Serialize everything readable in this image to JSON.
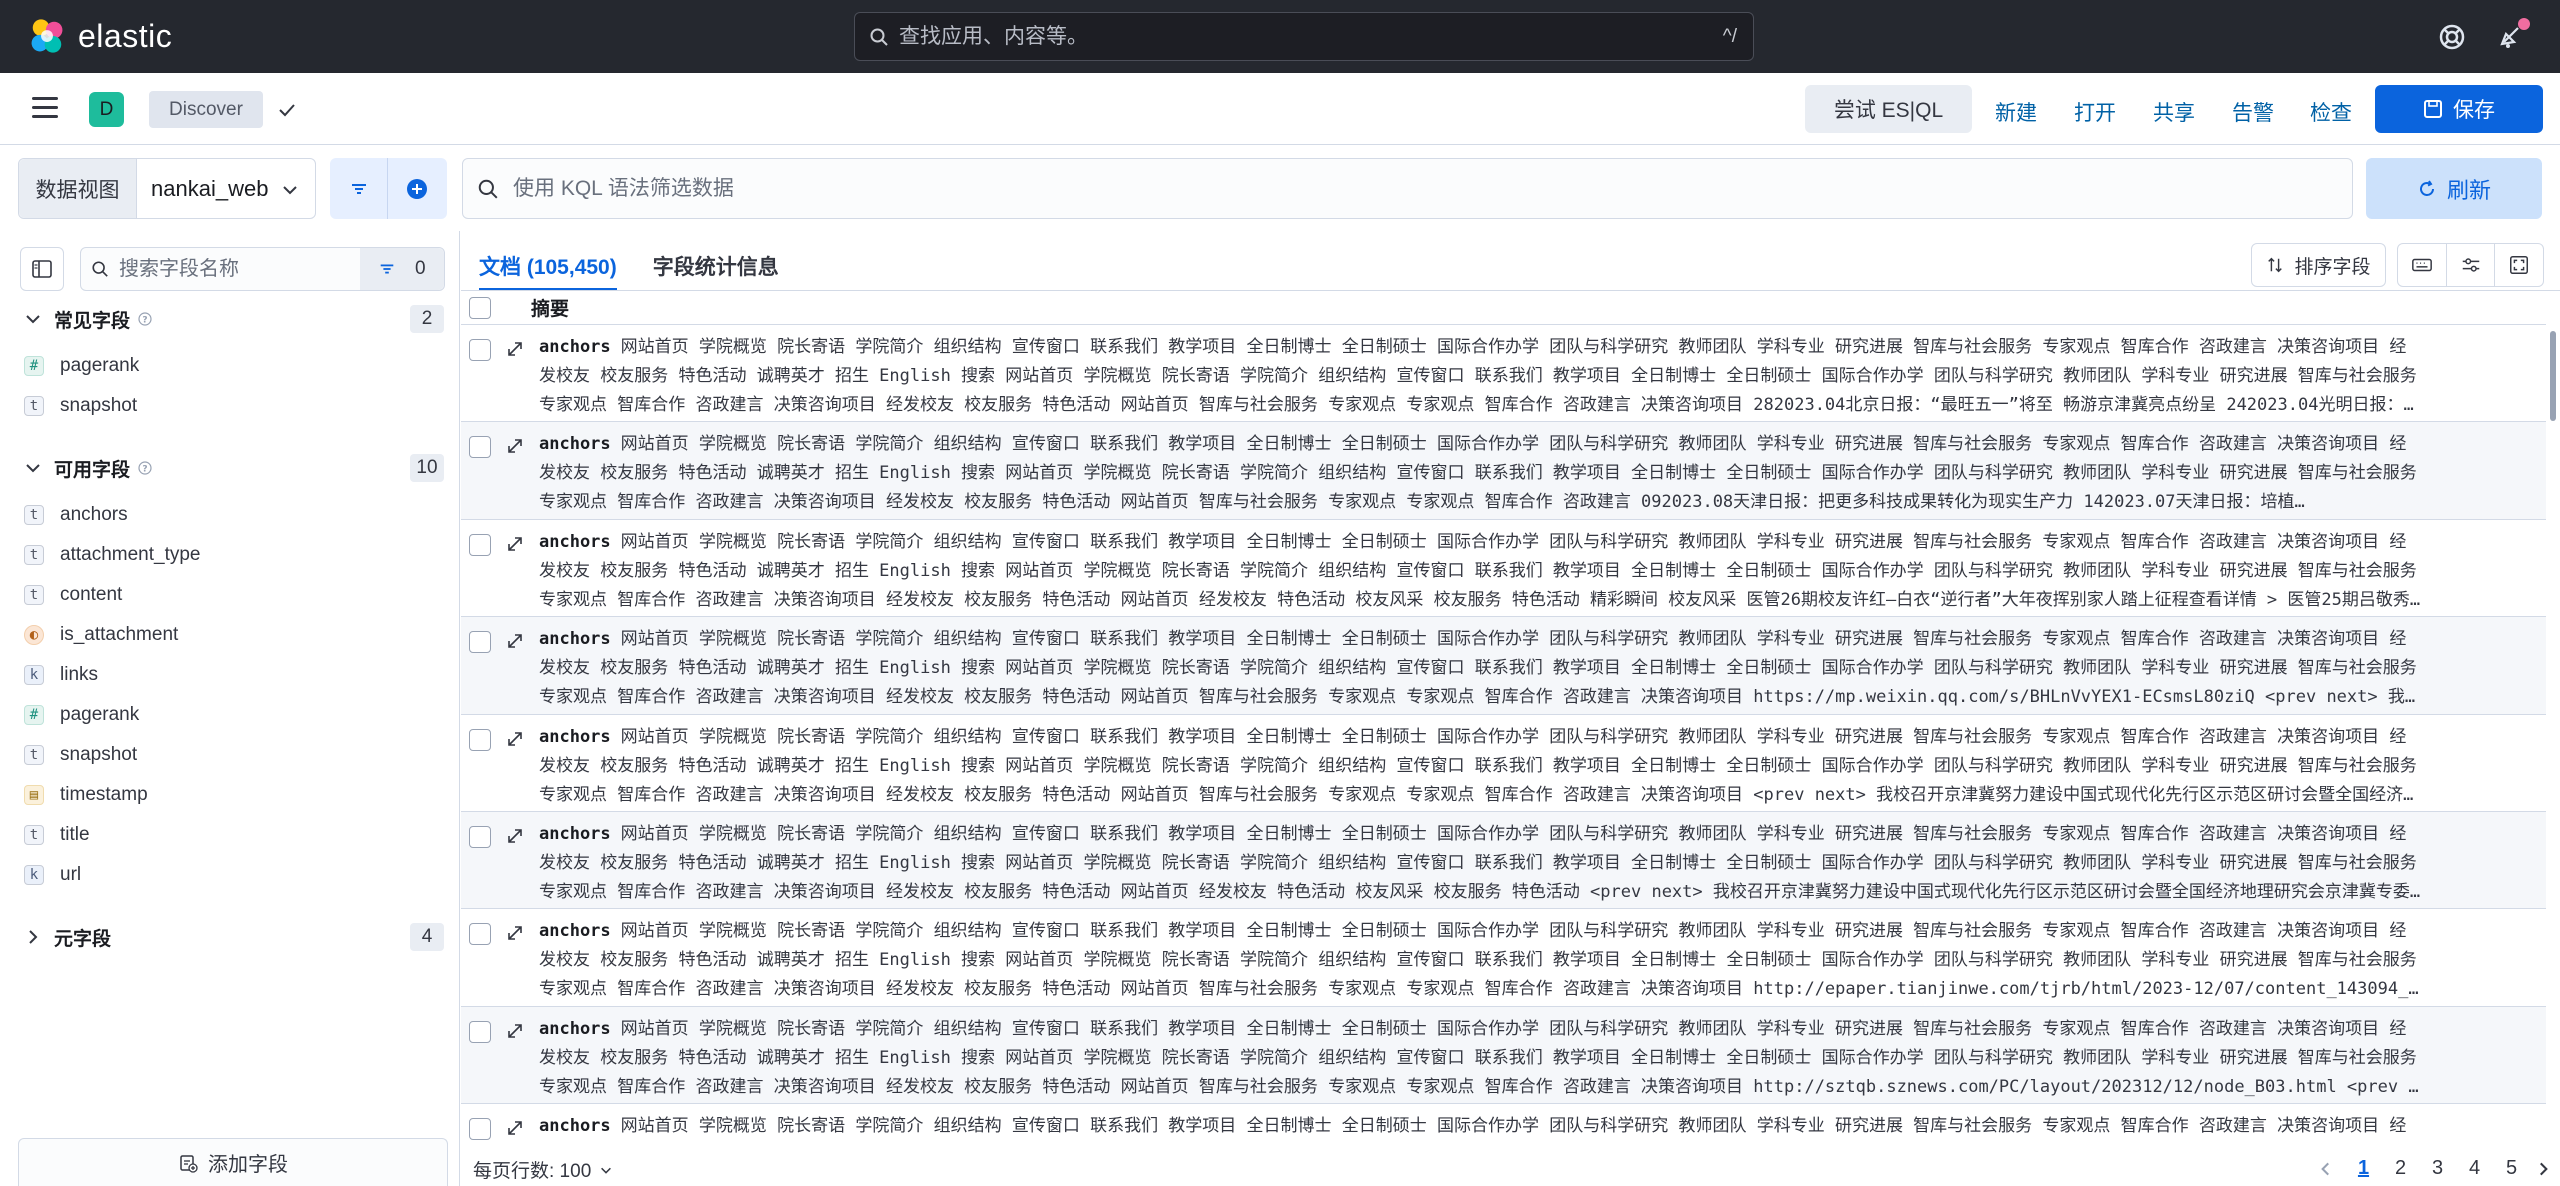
{
  "topbar": {
    "brand": "elastic",
    "search_placeholder": "查找应用、内容等。",
    "search_shortcut": "^/"
  },
  "appbar": {
    "space_letter": "D",
    "breadcrumb": "Discover",
    "esql_label": "尝试 ES|QL",
    "menu": {
      "new": "新建",
      "open": "打开",
      "share": "共享",
      "alerts": "告警",
      "inspect": "检查",
      "save": "保存"
    }
  },
  "querybar": {
    "dataview_label": "数据视图",
    "dataview_value": "nankai_web",
    "kql_placeholder": "使用 KQL 语法筛选数据",
    "refresh_label": "刷新"
  },
  "sidebar": {
    "search_placeholder": "搜索字段名称",
    "filter_count": "0",
    "sections": {
      "popular": {
        "title": "常见字段",
        "count": "2",
        "fields": [
          {
            "name": "pagerank",
            "type": "#"
          },
          {
            "name": "snapshot",
            "type": "t"
          }
        ]
      },
      "available": {
        "title": "可用字段",
        "count": "10",
        "fields": [
          {
            "name": "anchors",
            "type": "t"
          },
          {
            "name": "attachment_type",
            "type": "t"
          },
          {
            "name": "content",
            "type": "t"
          },
          {
            "name": "is_attachment",
            "type": "◐"
          },
          {
            "name": "links",
            "type": "k"
          },
          {
            "name": "pagerank",
            "type": "#"
          },
          {
            "name": "snapshot",
            "type": "t"
          },
          {
            "name": "timestamp",
            "type": "▤"
          },
          {
            "name": "title",
            "type": "t"
          },
          {
            "name": "url",
            "type": "k"
          }
        ]
      },
      "meta": {
        "title": "元字段",
        "count": "4"
      }
    },
    "add_field": "添加字段"
  },
  "main": {
    "tabs": {
      "documents": "文档 (105,450)",
      "field_stats": "字段统计信息"
    },
    "sort_fields": "排序字段",
    "column_header": "摘要",
    "rows": [
      {
        "key": "anchors",
        "line1": "网站首页 学院概览 院长寄语 学院简介 组织结构 宣传窗口 联系我们 教学项目 全日制博士 全日制硕士 国际合作办学 团队与科学研究 教师团队 学科专业 研究进展 智库与社会服务 专家观点 智库合作 咨政建言 决策咨询项目 经",
        "line2": "发校友 校友服务 特色活动 诚聘英才 招生 English 搜索 网站首页 学院概览 院长寄语 学院简介 组织结构 宣传窗口 联系我们 教学项目 全日制博士 全日制硕士 国际合作办学 团队与科学研究 教师团队 学科专业 研究进展 智库与社会服务",
        "line3": "专家观点 智库合作 咨政建言 决策咨询项目 经发校友 校友服务 特色活动 网站首页 智库与社会服务 专家观点 专家观点 智库合作 咨政建言 决策咨询项目 282023.04北京日报：“最旺五一”将至 畅游京津冀亮点纷呈 242023.04光明日报：…"
      },
      {
        "key": "anchors",
        "line1": "网站首页 学院概览 院长寄语 学院简介 组织结构 宣传窗口 联系我们 教学项目 全日制博士 全日制硕士 国际合作办学 团队与科学研究 教师团队 学科专业 研究进展 智库与社会服务 专家观点 智库合作 咨政建言 决策咨询项目 经",
        "line2": "发校友 校友服务 特色活动 诚聘英才 招生 English 搜索 网站首页 学院概览 院长寄语 学院简介 组织结构 宣传窗口 联系我们 教学项目 全日制博士 全日制硕士 国际合作办学 团队与科学研究 教师团队 学科专业 研究进展 智库与社会服务",
        "line3": "专家观点 智库合作 咨政建言 决策咨询项目 经发校友 校友服务 特色活动 网站首页 智库与社会服务 专家观点 专家观点 智库合作 咨政建言 092023.08天津日报：把更多科技成果转化为现实生产力 142023.07天津日报：培植…"
      },
      {
        "key": "anchors",
        "line1": "网站首页 学院概览 院长寄语 学院简介 组织结构 宣传窗口 联系我们 教学项目 全日制博士 全日制硕士 国际合作办学 团队与科学研究 教师团队 学科专业 研究进展 智库与社会服务 专家观点 智库合作 咨政建言 决策咨询项目 经",
        "line2": "发校友 校友服务 特色活动 诚聘英才 招生 English 搜索 网站首页 学院概览 院长寄语 学院简介 组织结构 宣传窗口 联系我们 教学项目 全日制博士 全日制硕士 国际合作办学 团队与科学研究 教师团队 学科专业 研究进展 智库与社会服务",
        "line3": "专家观点 智库合作 咨政建言 决策咨询项目 经发校友 校友服务 特色活动 网站首页 经发校友 特色活动 校友风采 校友服务 特色活动 精彩瞬间 校友风采 医管26期校友许红—白衣“逆行者”大年夜挥别家人踏上征程查看详情 > 医管25期吕敬秀…"
      },
      {
        "key": "anchors",
        "line1": "网站首页 学院概览 院长寄语 学院简介 组织结构 宣传窗口 联系我们 教学项目 全日制博士 全日制硕士 国际合作办学 团队与科学研究 教师团队 学科专业 研究进展 智库与社会服务 专家观点 智库合作 咨政建言 决策咨询项目 经",
        "line2": "发校友 校友服务 特色活动 诚聘英才 招生 English 搜索 网站首页 学院概览 院长寄语 学院简介 组织结构 宣传窗口 联系我们 教学项目 全日制博士 全日制硕士 国际合作办学 团队与科学研究 教师团队 学科专业 研究进展 智库与社会服务",
        "line3": "专家观点 智库合作 咨政建言 决策咨询项目 经发校友 校友服务 特色活动 网站首页 智库与社会服务 专家观点 专家观点 智库合作 咨政建言 决策咨询项目 https://mp.weixin.qq.com/s/BHLnVvYEX1-ECsmsL80ziQ <prev next> 我…"
      },
      {
        "key": "anchors",
        "line1": "网站首页 学院概览 院长寄语 学院简介 组织结构 宣传窗口 联系我们 教学项目 全日制博士 全日制硕士 国际合作办学 团队与科学研究 教师团队 学科专业 研究进展 智库与社会服务 专家观点 智库合作 咨政建言 决策咨询项目 经",
        "line2": "发校友 校友服务 特色活动 诚聘英才 招生 English 搜索 网站首页 学院概览 院长寄语 学院简介 组织结构 宣传窗口 联系我们 教学项目 全日制博士 全日制硕士 国际合作办学 团队与科学研究 教师团队 学科专业 研究进展 智库与社会服务",
        "line3": "专家观点 智库合作 咨政建言 决策咨询项目 经发校友 校友服务 特色活动 网站首页 智库与社会服务 专家观点 专家观点 智库合作 咨政建言 决策咨询项目 <prev next> 我校召开京津冀努力建设中国式现代化先行区示范区研讨会暨全国经济…"
      },
      {
        "key": "anchors",
        "line1": "网站首页 学院概览 院长寄语 学院简介 组织结构 宣传窗口 联系我们 教学项目 全日制博士 全日制硕士 国际合作办学 团队与科学研究 教师团队 学科专业 研究进展 智库与社会服务 专家观点 智库合作 咨政建言 决策咨询项目 经",
        "line2": "发校友 校友服务 特色活动 诚聘英才 招生 English 搜索 网站首页 学院概览 院长寄语 学院简介 组织结构 宣传窗口 联系我们 教学项目 全日制博士 全日制硕士 国际合作办学 团队与科学研究 教师团队 学科专业 研究进展 智库与社会服务",
        "line3": "专家观点 智库合作 咨政建言 决策咨询项目 经发校友 校友服务 特色活动 网站首页 经发校友 特色活动 校友风采 校友服务 特色活动 <prev next> 我校召开京津冀努力建设中国式现代化先行区示范区研讨会暨全国经济地理研究会京津冀专委…"
      },
      {
        "key": "anchors",
        "line1": "网站首页 学院概览 院长寄语 学院简介 组织结构 宣传窗口 联系我们 教学项目 全日制博士 全日制硕士 国际合作办学 团队与科学研究 教师团队 学科专业 研究进展 智库与社会服务 专家观点 智库合作 咨政建言 决策咨询项目 经",
        "line2": "发校友 校友服务 特色活动 诚聘英才 招生 English 搜索 网站首页 学院概览 院长寄语 学院简介 组织结构 宣传窗口 联系我们 教学项目 全日制博士 全日制硕士 国际合作办学 团队与科学研究 教师团队 学科专业 研究进展 智库与社会服务",
        "line3": "专家观点 智库合作 咨政建言 决策咨询项目 经发校友 校友服务 特色活动 网站首页 智库与社会服务 专家观点 专家观点 智库合作 咨政建言 决策咨询项目 http://epaper.tianjinwe.com/tjrb/html/2023-12/07/content_143094_…"
      },
      {
        "key": "anchors",
        "line1": "网站首页 学院概览 院长寄语 学院简介 组织结构 宣传窗口 联系我们 教学项目 全日制博士 全日制硕士 国际合作办学 团队与科学研究 教师团队 学科专业 研究进展 智库与社会服务 专家观点 智库合作 咨政建言 决策咨询项目 经",
        "line2": "发校友 校友服务 特色活动 诚聘英才 招生 English 搜索 网站首页 学院概览 院长寄语 学院简介 组织结构 宣传窗口 联系我们 教学项目 全日制博士 全日制硕士 国际合作办学 团队与科学研究 教师团队 学科专业 研究进展 智库与社会服务",
        "line3": "专家观点 智库合作 咨政建言 决策咨询项目 经发校友 校友服务 特色活动 网站首页 智库与社会服务 专家观点 专家观点 智库合作 咨政建言 决策咨询项目 http://sztqb.sznews.com/PC/layout/202312/12/node_B03.html <prev …"
      },
      {
        "key": "anchors",
        "line1": "网站首页 学院概览 院长寄语 学院简介 组织结构 宣传窗口 联系我们 教学项目 全日制博士 全日制硕士 国际合作办学 团队与科学研究 教师团队 学科专业 研究进展 智库与社会服务 专家观点 智库合作 咨政建言 决策咨询项目 经",
        "line2": "",
        "line3": ""
      }
    ],
    "footer": {
      "rows_per_page": "每页行数: 100",
      "pages": [
        "1",
        "2",
        "3",
        "4",
        "5"
      ]
    }
  },
  "colors": {
    "topbar_bg": "#25282f",
    "primary": "#0b64dd",
    "link": "#0061a6",
    "space_avatar": "#1ebc9c"
  }
}
